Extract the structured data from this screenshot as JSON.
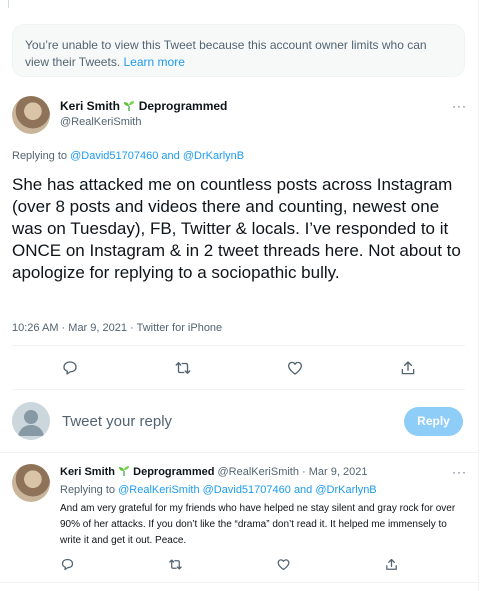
{
  "notice": {
    "text": "You’re unable to view this Tweet because this account owner limits who can view their Tweets.",
    "link": "Learn more"
  },
  "main_tweet": {
    "author_name": "Keri Smith",
    "author_suffix": "Deprogrammed",
    "handle": "@RealKeriSmith",
    "replying_to_label": "Replying to",
    "reply_user_1": "@David51707460",
    "and_label": "and",
    "reply_user_2": "@DrKarlynB",
    "text": "She has attacked me on countless posts across Instagram (over 8 posts and videos there and counting, newest one was on Tuesday), FB, Twitter & locals. I’ve responded to it ONCE on Instagram & in 2 tweet threads here. Not about to apologize for replying to a sociopathic bully.",
    "time": "10:26 AM",
    "date": "Mar 9, 2021",
    "source": "Twitter for iPhone",
    "more": "···"
  },
  "compose": {
    "placeholder": "Tweet your reply",
    "reply_button": "Reply"
  },
  "reply_tweet": {
    "author_name": "Keri Smith",
    "author_suffix": "Deprogrammed",
    "handle": "@RealKeriSmith",
    "date": "Mar 9, 2021",
    "replying_to_label": "Replying to",
    "reply_user_1": "@RealKeriSmith",
    "reply_user_2": "@David51707460",
    "and_label": "and",
    "reply_user_3": "@DrKarlynB",
    "text": "And am very grateful for my friends who have helped ne stay silent and gray rock for over 90% of her attacks. If you don’t like the “drama” don’t read it. It helped me immensely to write it and get it out. Peace.",
    "more": "···"
  },
  "colors": {
    "accent": "#1d9bf0",
    "muted": "#536471",
    "reply_button_disabled": "#8ecdf8"
  },
  "icons": [
    "seedling-icon",
    "reply-icon",
    "retweet-icon",
    "like-icon",
    "share-icon",
    "more-icon"
  ]
}
